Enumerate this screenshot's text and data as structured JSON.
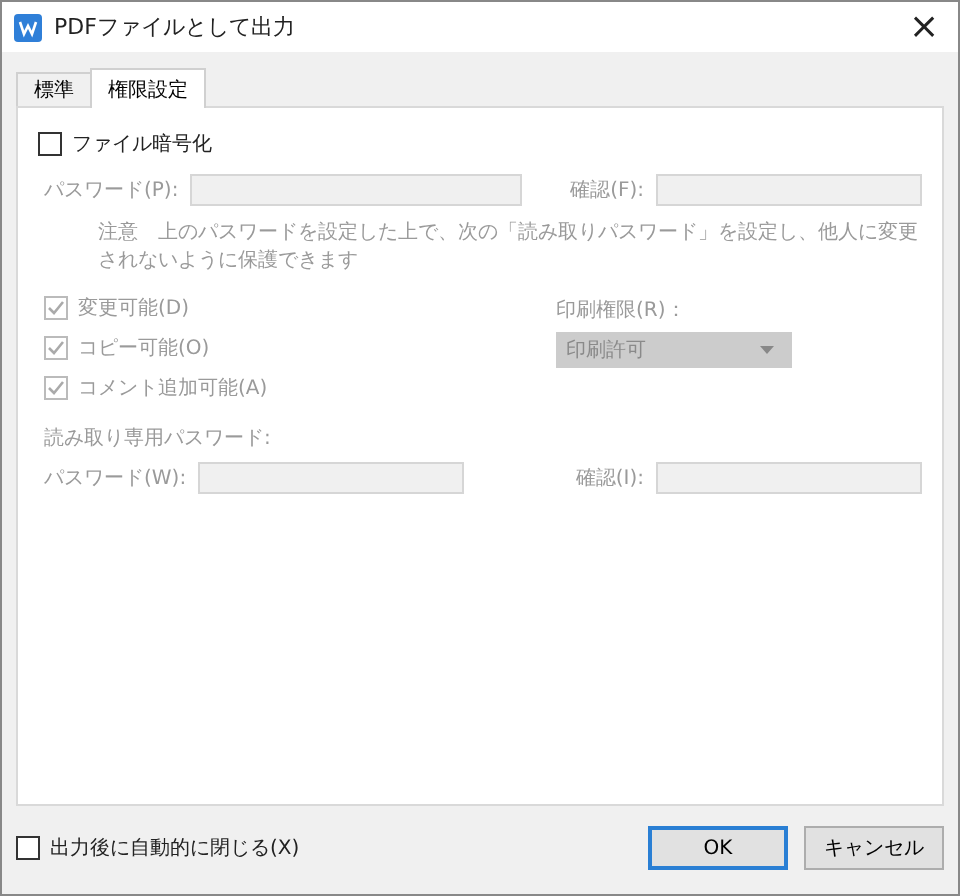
{
  "window": {
    "title": "PDFファイルとして出力",
    "close": "×"
  },
  "tabs": [
    {
      "label": "標準",
      "selected": false
    },
    {
      "label": "権限設定",
      "selected": true
    }
  ],
  "encrypt": {
    "label": "ファイル暗号化",
    "checked": false
  },
  "password": {
    "label": "パスワード(P):",
    "disabled": true
  },
  "confirm": {
    "label": "確認(F):",
    "disabled": true
  },
  "note": "注意　上のパスワードを設定した上で、次の「読み取りパスワード」を設定し、他人に変更されないように保護できます",
  "permissions": [
    {
      "label": "変更可能(D)",
      "checked": true,
      "disabled": true
    },
    {
      "label": "コピー可能(O)",
      "checked": true,
      "disabled": true
    },
    {
      "label": "コメント追加可能(A)",
      "checked": true,
      "disabled": true
    }
  ],
  "print": {
    "label": "印刷権限(R)：",
    "value": "印刷許可",
    "disabled": true
  },
  "readonly": {
    "heading": "読み取り専用パスワード:",
    "password_label": "パスワード(W):",
    "confirm_label": "確認(I):",
    "disabled": true
  },
  "auto_close": {
    "label": "出力後に自動的に閉じる(X)",
    "checked": false
  },
  "buttons": [
    {
      "label": "OK",
      "kind": "primary"
    },
    {
      "label": "キャンセル",
      "kind": "secondary"
    }
  ]
}
